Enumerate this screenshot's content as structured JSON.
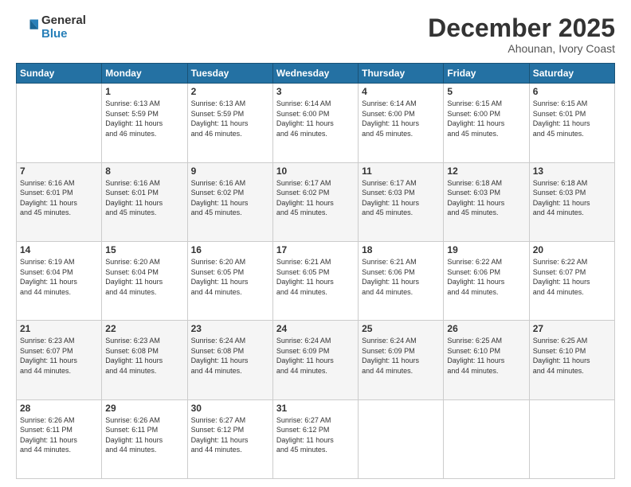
{
  "header": {
    "logo_general": "General",
    "logo_blue": "Blue",
    "month_title": "December 2025",
    "subtitle": "Ahounan, Ivory Coast"
  },
  "days_of_week": [
    "Sunday",
    "Monday",
    "Tuesday",
    "Wednesday",
    "Thursday",
    "Friday",
    "Saturday"
  ],
  "weeks": [
    [
      {
        "day": "",
        "info": ""
      },
      {
        "day": "1",
        "info": "Sunrise: 6:13 AM\nSunset: 5:59 PM\nDaylight: 11 hours\nand 46 minutes."
      },
      {
        "day": "2",
        "info": "Sunrise: 6:13 AM\nSunset: 5:59 PM\nDaylight: 11 hours\nand 46 minutes."
      },
      {
        "day": "3",
        "info": "Sunrise: 6:14 AM\nSunset: 6:00 PM\nDaylight: 11 hours\nand 46 minutes."
      },
      {
        "day": "4",
        "info": "Sunrise: 6:14 AM\nSunset: 6:00 PM\nDaylight: 11 hours\nand 45 minutes."
      },
      {
        "day": "5",
        "info": "Sunrise: 6:15 AM\nSunset: 6:00 PM\nDaylight: 11 hours\nand 45 minutes."
      },
      {
        "day": "6",
        "info": "Sunrise: 6:15 AM\nSunset: 6:01 PM\nDaylight: 11 hours\nand 45 minutes."
      }
    ],
    [
      {
        "day": "7",
        "info": "Sunrise: 6:16 AM\nSunset: 6:01 PM\nDaylight: 11 hours\nand 45 minutes."
      },
      {
        "day": "8",
        "info": "Sunrise: 6:16 AM\nSunset: 6:01 PM\nDaylight: 11 hours\nand 45 minutes."
      },
      {
        "day": "9",
        "info": "Sunrise: 6:16 AM\nSunset: 6:02 PM\nDaylight: 11 hours\nand 45 minutes."
      },
      {
        "day": "10",
        "info": "Sunrise: 6:17 AM\nSunset: 6:02 PM\nDaylight: 11 hours\nand 45 minutes."
      },
      {
        "day": "11",
        "info": "Sunrise: 6:17 AM\nSunset: 6:03 PM\nDaylight: 11 hours\nand 45 minutes."
      },
      {
        "day": "12",
        "info": "Sunrise: 6:18 AM\nSunset: 6:03 PM\nDaylight: 11 hours\nand 45 minutes."
      },
      {
        "day": "13",
        "info": "Sunrise: 6:18 AM\nSunset: 6:03 PM\nDaylight: 11 hours\nand 44 minutes."
      }
    ],
    [
      {
        "day": "14",
        "info": "Sunrise: 6:19 AM\nSunset: 6:04 PM\nDaylight: 11 hours\nand 44 minutes."
      },
      {
        "day": "15",
        "info": "Sunrise: 6:20 AM\nSunset: 6:04 PM\nDaylight: 11 hours\nand 44 minutes."
      },
      {
        "day": "16",
        "info": "Sunrise: 6:20 AM\nSunset: 6:05 PM\nDaylight: 11 hours\nand 44 minutes."
      },
      {
        "day": "17",
        "info": "Sunrise: 6:21 AM\nSunset: 6:05 PM\nDaylight: 11 hours\nand 44 minutes."
      },
      {
        "day": "18",
        "info": "Sunrise: 6:21 AM\nSunset: 6:06 PM\nDaylight: 11 hours\nand 44 minutes."
      },
      {
        "day": "19",
        "info": "Sunrise: 6:22 AM\nSunset: 6:06 PM\nDaylight: 11 hours\nand 44 minutes."
      },
      {
        "day": "20",
        "info": "Sunrise: 6:22 AM\nSunset: 6:07 PM\nDaylight: 11 hours\nand 44 minutes."
      }
    ],
    [
      {
        "day": "21",
        "info": "Sunrise: 6:23 AM\nSunset: 6:07 PM\nDaylight: 11 hours\nand 44 minutes."
      },
      {
        "day": "22",
        "info": "Sunrise: 6:23 AM\nSunset: 6:08 PM\nDaylight: 11 hours\nand 44 minutes."
      },
      {
        "day": "23",
        "info": "Sunrise: 6:24 AM\nSunset: 6:08 PM\nDaylight: 11 hours\nand 44 minutes."
      },
      {
        "day": "24",
        "info": "Sunrise: 6:24 AM\nSunset: 6:09 PM\nDaylight: 11 hours\nand 44 minutes."
      },
      {
        "day": "25",
        "info": "Sunrise: 6:24 AM\nSunset: 6:09 PM\nDaylight: 11 hours\nand 44 minutes."
      },
      {
        "day": "26",
        "info": "Sunrise: 6:25 AM\nSunset: 6:10 PM\nDaylight: 11 hours\nand 44 minutes."
      },
      {
        "day": "27",
        "info": "Sunrise: 6:25 AM\nSunset: 6:10 PM\nDaylight: 11 hours\nand 44 minutes."
      }
    ],
    [
      {
        "day": "28",
        "info": "Sunrise: 6:26 AM\nSunset: 6:11 PM\nDaylight: 11 hours\nand 44 minutes."
      },
      {
        "day": "29",
        "info": "Sunrise: 6:26 AM\nSunset: 6:11 PM\nDaylight: 11 hours\nand 44 minutes."
      },
      {
        "day": "30",
        "info": "Sunrise: 6:27 AM\nSunset: 6:12 PM\nDaylight: 11 hours\nand 44 minutes."
      },
      {
        "day": "31",
        "info": "Sunrise: 6:27 AM\nSunset: 6:12 PM\nDaylight: 11 hours\nand 45 minutes."
      },
      {
        "day": "",
        "info": ""
      },
      {
        "day": "",
        "info": ""
      },
      {
        "day": "",
        "info": ""
      }
    ]
  ]
}
